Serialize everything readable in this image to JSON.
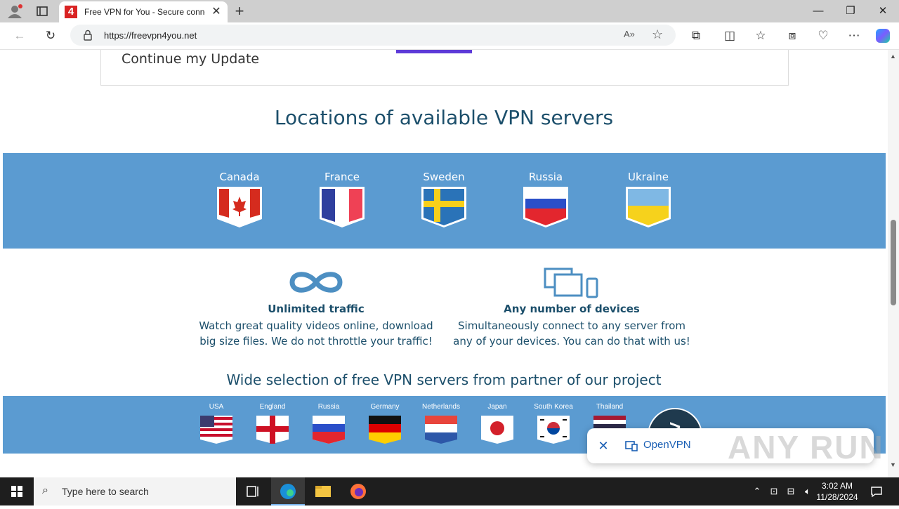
{
  "browser": {
    "tab_title": "Free VPN for You - Secure conne",
    "tab_favicon_text": "4",
    "url": "https://freevpn4you.net",
    "new_tab_symbol": "+"
  },
  "page": {
    "update_text": "Continue my Update",
    "locations_heading": "Locations of available VPN servers",
    "locations": [
      {
        "name": "Canada"
      },
      {
        "name": "France"
      },
      {
        "name": "Sweden"
      },
      {
        "name": "Russia"
      },
      {
        "name": "Ukraine"
      }
    ],
    "features": [
      {
        "title": "Unlimited traffic",
        "desc1": "Watch great quality videos online, download",
        "desc2": "big size files. We do not throttle your traffic!",
        "icon": "infinity-icon"
      },
      {
        "title": "Any number of devices",
        "desc1": "Simultaneously connect to any server from",
        "desc2": "any of your devices. You can do that with us!",
        "icon": "devices-icon"
      }
    ],
    "partner_heading": "Wide selection of free VPN servers from partner of our project",
    "partner_countries": [
      {
        "name": "USA"
      },
      {
        "name": "England"
      },
      {
        "name": "Russia"
      },
      {
        "name": "Germany"
      },
      {
        "name": "Netherlands"
      },
      {
        "name": "Japan"
      },
      {
        "name": "South Korea"
      },
      {
        "name": "Thailand"
      }
    ],
    "next_symbol": ">"
  },
  "toast": {
    "label": "OpenVPN",
    "close_symbol": "✕"
  },
  "watermark": "ANY RUN",
  "taskbar": {
    "search_placeholder": "Type here to search",
    "time": "3:02 AM",
    "date": "11/28/2024"
  },
  "colors": {
    "band": "#5b9bd1",
    "heading": "#1c4f6b",
    "accent_purple": "#5d3bd8"
  }
}
